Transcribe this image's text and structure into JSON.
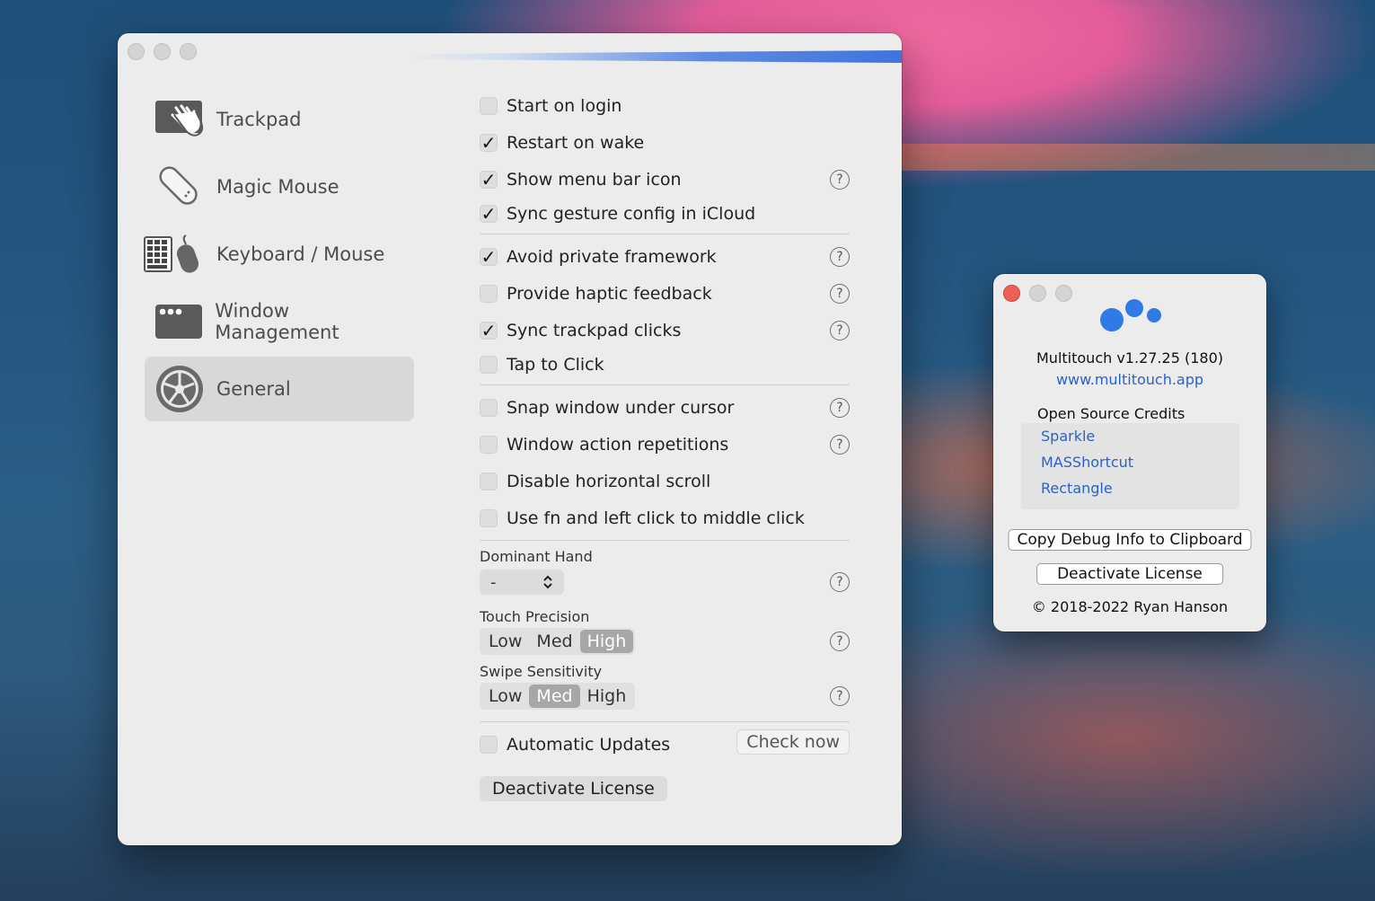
{
  "main_window": {
    "sidebar": {
      "items": [
        {
          "label": "Trackpad",
          "icon": "trackpad-hand-icon"
        },
        {
          "label": "Magic Mouse",
          "icon": "magic-mouse-icon"
        },
        {
          "label": "Keyboard / Mouse",
          "icon": "keyboard-mouse-icon"
        },
        {
          "label": "Window Management",
          "icon": "window-icon"
        },
        {
          "label": "General",
          "icon": "gear-icon",
          "selected": true
        }
      ]
    },
    "settings": {
      "group1": [
        {
          "label": "Start on login",
          "checked": false
        },
        {
          "label": "Restart on wake",
          "checked": true
        },
        {
          "label": "Show menu bar icon",
          "checked": true,
          "help": true
        },
        {
          "label": "Sync gesture config in iCloud",
          "checked": true
        }
      ],
      "group2": [
        {
          "label": "Avoid private framework",
          "checked": true,
          "help": true
        },
        {
          "label": "Provide haptic feedback",
          "checked": false,
          "help": true
        },
        {
          "label": "Sync trackpad clicks",
          "checked": true,
          "help": true
        },
        {
          "label": "Tap to Click",
          "checked": false
        }
      ],
      "group3": [
        {
          "label": "Snap window under cursor",
          "checked": false,
          "help": true
        },
        {
          "label": "Window action repetitions",
          "checked": false,
          "help": true
        },
        {
          "label": "Disable horizontal scroll",
          "checked": false
        },
        {
          "label": "Use fn and left click to middle click",
          "checked": false
        }
      ],
      "dominant_hand": {
        "label": "Dominant Hand",
        "value": "-"
      },
      "touch_precision": {
        "label": "Touch Precision",
        "options": [
          "Low",
          "Med",
          "High"
        ],
        "selected": "High"
      },
      "swipe_sensitivity": {
        "label": "Swipe Sensitivity",
        "options": [
          "Low",
          "Med",
          "High"
        ],
        "selected": "Med"
      },
      "automatic_updates": {
        "label": "Automatic Updates",
        "checked": false,
        "check_now": "Check now"
      },
      "deactivate_license": "Deactivate License",
      "help_glyph": "?",
      "check_glyph": "✓"
    }
  },
  "about_window": {
    "version": "Multitouch v1.27.25 (180)",
    "website": "www.multitouch.app",
    "credits_title": "Open Source Credits",
    "credits": [
      "Sparkle",
      "MASShortcut",
      "Rectangle"
    ],
    "copy_debug": "Copy Debug Info to Clipboard",
    "deactivate_license": "Deactivate License",
    "copyright": "© 2018-2022 Ryan Hanson",
    "logo_color": "#2f7ae5",
    "close_color": "#ee5f57"
  }
}
